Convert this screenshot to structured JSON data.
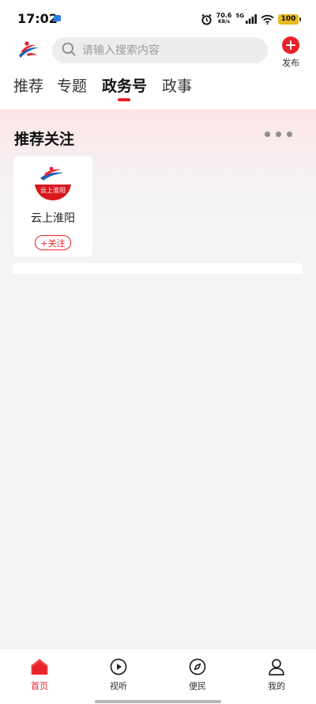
{
  "status_bar": {
    "time": "17:02",
    "net_speed_value": "70.6",
    "net_speed_unit": "KB/s",
    "network": "5G",
    "battery": "100"
  },
  "header": {
    "search_placeholder": "请输入搜索内容",
    "publish_label": "发布"
  },
  "tabs": [
    {
      "label": "推荐",
      "active": false
    },
    {
      "label": "专题",
      "active": false
    },
    {
      "label": "政务号",
      "active": true
    },
    {
      "label": "政事",
      "active": false
    }
  ],
  "recommend": {
    "title": "推荐关注",
    "cards": [
      {
        "name": "云上淮阳",
        "avatar_text": "云上淮阳",
        "follow_label": "+关注"
      }
    ]
  },
  "bottom_nav": [
    {
      "label": "首页",
      "icon": "home-icon",
      "active": true
    },
    {
      "label": "视听",
      "icon": "play-icon",
      "active": false
    },
    {
      "label": "便民",
      "icon": "compass-icon",
      "active": false
    },
    {
      "label": "我的",
      "icon": "user-icon",
      "active": false
    }
  ],
  "colors": {
    "accent": "#e8232a",
    "brand_blue": "#1f5fb4",
    "battery": "#e8b820"
  }
}
